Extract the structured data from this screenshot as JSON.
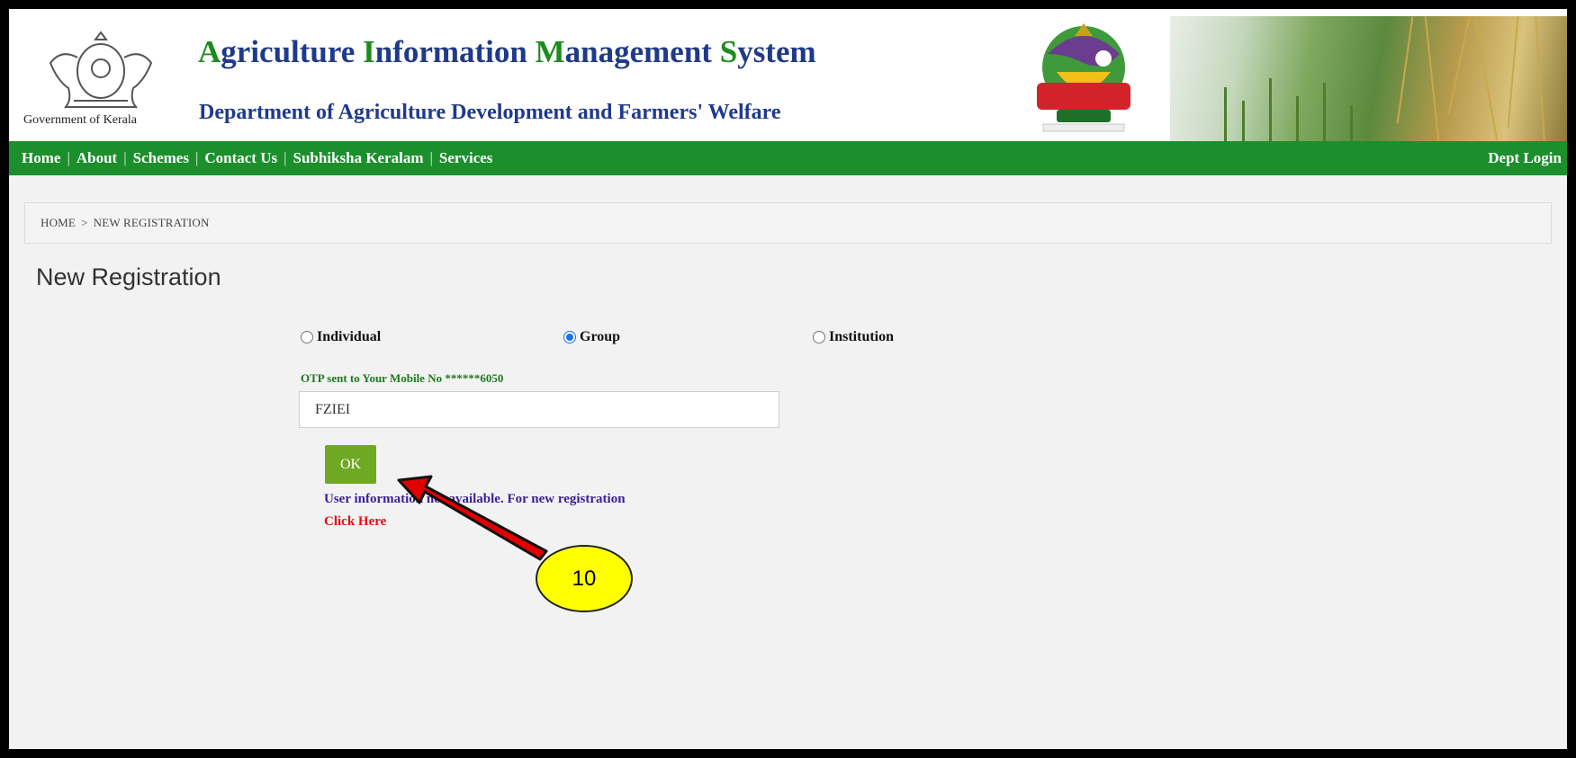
{
  "header": {
    "gov_label": "Government of Kerala",
    "title_parts": [
      {
        "cap": "A",
        "rest": "griculture "
      },
      {
        "cap": "I",
        "rest": "nformation "
      },
      {
        "cap": "M",
        "rest": "anagement "
      },
      {
        "cap": "S",
        "rest": "ystem"
      }
    ],
    "subtitle": "Department of Agriculture Development and Farmers' Welfare"
  },
  "nav": {
    "items": [
      "Home",
      "About",
      "Schemes",
      "Contact Us",
      "Subhiksha Keralam",
      "Services"
    ],
    "separator": "|",
    "dept_login": "Dept Login"
  },
  "breadcrumb": {
    "home": "HOME",
    "separator": ">",
    "current": "NEW REGISTRATION"
  },
  "page": {
    "title": "New Registration"
  },
  "registration_type": {
    "options": [
      "Individual",
      "Group",
      "Institution"
    ],
    "selected": "Group"
  },
  "otp": {
    "label": "OTP sent to Your Mobile No ******6050",
    "value": "FZIEI",
    "ok_label": "OK"
  },
  "message": {
    "info": "User information not available. For new registration",
    "link": "Click Here"
  },
  "annotation": {
    "step": "10"
  },
  "colors": {
    "nav_green": "#1b8f2c",
    "title_blue": "#1f3a8a",
    "title_green": "#1c8c1c",
    "ok_green": "#6fa822",
    "link_red": "#e01010",
    "badge_yellow": "#ffff00",
    "arrow_red": "#e00000"
  }
}
